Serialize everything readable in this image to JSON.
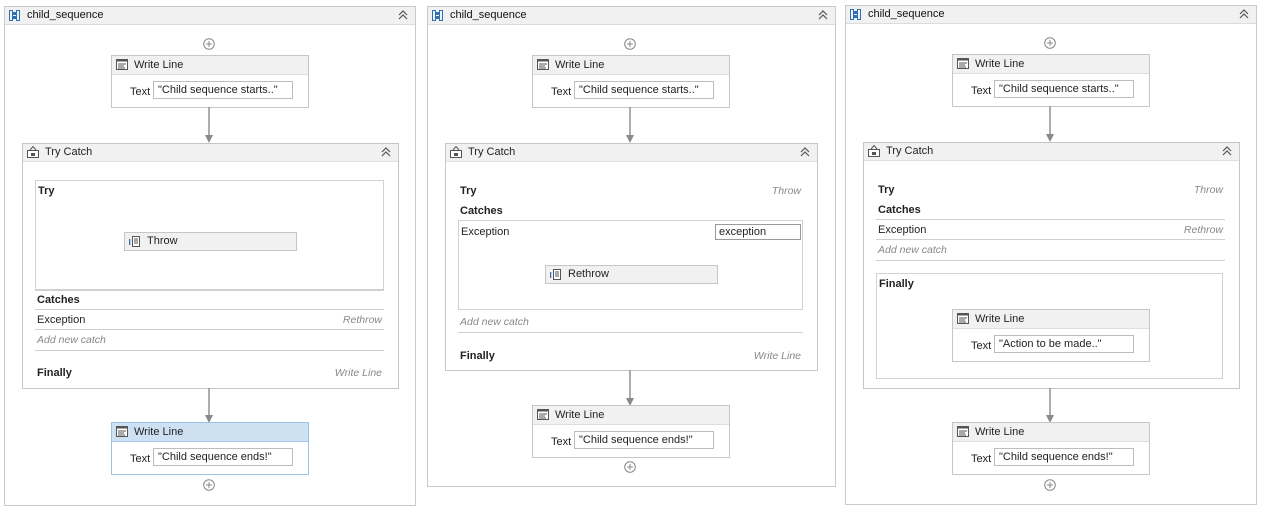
{
  "panels": [
    {
      "title": "child_sequence",
      "start_write": {
        "title": "Write Line",
        "text_label": "Text",
        "text_value": "\"Child sequence starts..\""
      },
      "try_catch": {
        "title": "Try Catch",
        "try_label": "Try",
        "try_activity": "Throw",
        "catches_label": "Catches",
        "exception_label": "Exception",
        "exception_action": "Rethrow",
        "add_catch": "Add new catch",
        "finally_label": "Finally",
        "finally_action": "Write Line"
      },
      "end_write": {
        "title": "Write Line",
        "text_label": "Text",
        "text_value": "\"Child sequence ends!\""
      }
    },
    {
      "title": "child_sequence",
      "start_write": {
        "title": "Write Line",
        "text_label": "Text",
        "text_value": "\"Child sequence starts..\""
      },
      "try_catch": {
        "title": "Try Catch",
        "try_label": "Try",
        "try_action": "Throw",
        "catches_label": "Catches",
        "exception_label": "Exception",
        "exception_var": "exception",
        "catch_activity": "Rethrow",
        "add_catch": "Add new catch",
        "finally_label": "Finally",
        "finally_action": "Write Line"
      },
      "end_write": {
        "title": "Write Line",
        "text_label": "Text",
        "text_value": "\"Child sequence ends!\""
      }
    },
    {
      "title": "child_sequence",
      "start_write": {
        "title": "Write Line",
        "text_label": "Text",
        "text_value": "\"Child sequence starts..\""
      },
      "try_catch": {
        "title": "Try Catch",
        "try_label": "Try",
        "try_action": "Throw",
        "catches_label": "Catches",
        "exception_label": "Exception",
        "exception_action": "Rethrow",
        "add_catch": "Add new catch",
        "finally_label": "Finally",
        "finally_write": {
          "title": "Write Line",
          "text_label": "Text",
          "text_value": "\"Action to be made..\""
        }
      },
      "end_write": {
        "title": "Write Line",
        "text_label": "Text",
        "text_value": "\"Child sequence ends!\""
      }
    }
  ],
  "icons": {
    "sequence": "sequence-icon",
    "write_line": "write-line-icon",
    "try_catch": "try-catch-icon",
    "throw": "throw-icon",
    "rethrow": "rethrow-icon",
    "collapse": "collapse-chevron-icon",
    "add": "add-activity-icon"
  },
  "colors": {
    "header_bg": "#f1f1f1",
    "selected_header_bg": "#cde1f3",
    "border": "#c6c6c6",
    "icon_blue": "#2f6fb5"
  }
}
